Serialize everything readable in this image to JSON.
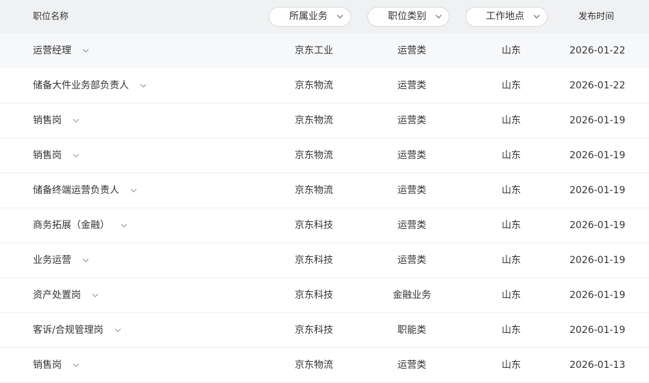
{
  "header": {
    "title_col": "职位名称",
    "filters": [
      {
        "label": "所属业务"
      },
      {
        "label": "职位类别"
      },
      {
        "label": "工作地点"
      }
    ],
    "date_col": "发布时间"
  },
  "rows": [
    {
      "title": "运营经理",
      "business": "京东工业",
      "category": "运营类",
      "location": "山东",
      "date": "2026-01-22"
    },
    {
      "title": "储备大件业务部负责人",
      "business": "京东物流",
      "category": "运营类",
      "location": "山东",
      "date": "2026-01-22"
    },
    {
      "title": "销售岗",
      "business": "京东物流",
      "category": "运营类",
      "location": "山东",
      "date": "2026-01-19"
    },
    {
      "title": "销售岗",
      "business": "京东物流",
      "category": "运营类",
      "location": "山东",
      "date": "2026-01-19"
    },
    {
      "title": "储备终端运营负责人",
      "business": "京东物流",
      "category": "运营类",
      "location": "山东",
      "date": "2026-01-19"
    },
    {
      "title": "商务拓展（金融）",
      "business": "京东科技",
      "category": "运营类",
      "location": "山东",
      "date": "2026-01-19"
    },
    {
      "title": "业务运营",
      "business": "京东科技",
      "category": "运营类",
      "location": "山东",
      "date": "2026-01-19"
    },
    {
      "title": "资产处置岗",
      "business": "京东科技",
      "category": "金融业务",
      "location": "山东",
      "date": "2026-01-19"
    },
    {
      "title": "客诉/合规管理岗",
      "business": "京东科技",
      "category": "职能类",
      "location": "山东",
      "date": "2026-01-19"
    },
    {
      "title": "销售岗",
      "business": "京东物流",
      "category": "运营类",
      "location": "山东",
      "date": "2026-01-13"
    }
  ]
}
